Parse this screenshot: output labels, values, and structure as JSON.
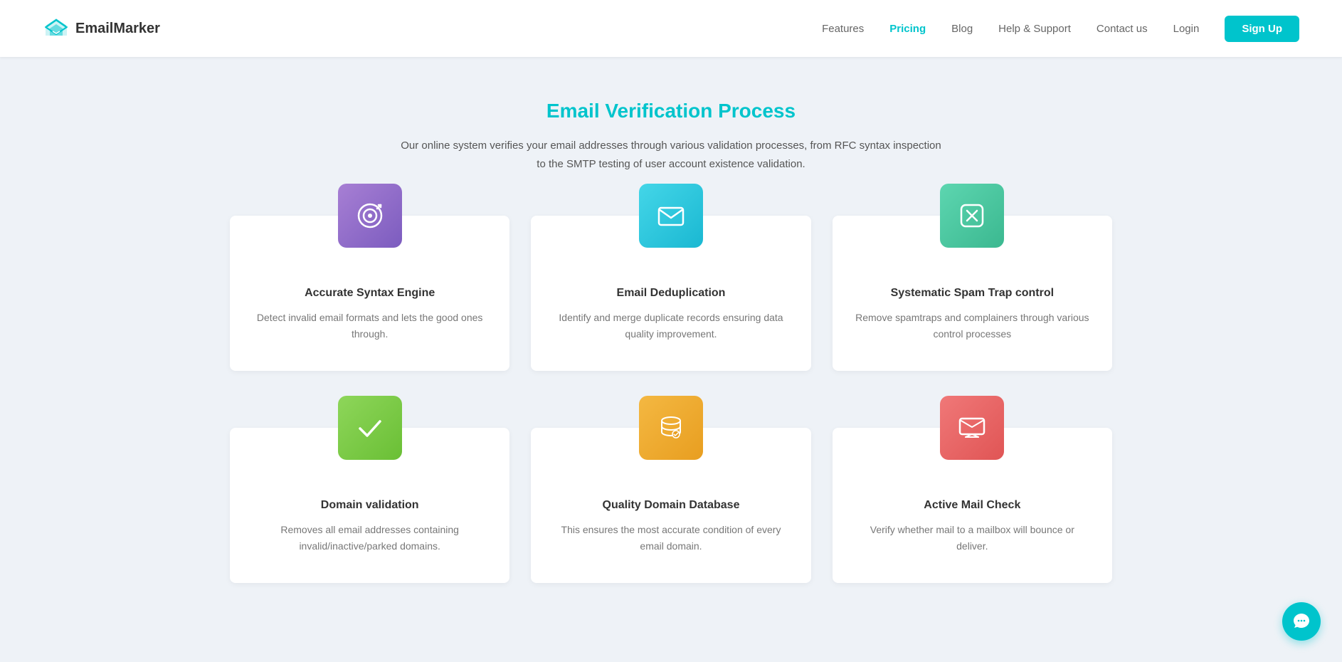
{
  "nav": {
    "logo_text": "EmailMarker",
    "links": [
      {
        "label": "Features",
        "active": false
      },
      {
        "label": "Pricing",
        "active": true
      },
      {
        "label": "Blog",
        "active": false
      },
      {
        "label": "Help & Support",
        "active": false
      },
      {
        "label": "Contact us",
        "active": false
      },
      {
        "label": "Login",
        "active": false
      }
    ],
    "signup_label": "Sign Up"
  },
  "section": {
    "title": "Email Verification Process",
    "subtitle": "Our online system verifies your email addresses through various validation processes, from RFC syntax inspection to the SMTP testing of user account existence validation."
  },
  "cards": [
    {
      "id": "syntax",
      "icon_color": "purple",
      "title": "Accurate Syntax Engine",
      "desc": "Detect invalid email formats and lets the good ones through."
    },
    {
      "id": "dedup",
      "icon_color": "cyan",
      "title": "Email Deduplication",
      "desc": "Identify and merge duplicate records ensuring data quality improvement."
    },
    {
      "id": "spam",
      "icon_color": "teal",
      "title": "Systematic Spam Trap control",
      "desc": "Remove spamtraps and complainers through various control processes"
    },
    {
      "id": "domain",
      "icon_color": "green",
      "title": "Domain validation",
      "desc": "Removes all email addresses containing invalid/inactive/parked domains."
    },
    {
      "id": "quality",
      "icon_color": "orange",
      "title": "Quality Domain Database",
      "desc": "This ensures the most accurate condition of every email domain."
    },
    {
      "id": "mail",
      "icon_color": "pink",
      "title": "Active Mail Check",
      "desc": "Verify whether mail to a mailbox will bounce or deliver."
    }
  ]
}
